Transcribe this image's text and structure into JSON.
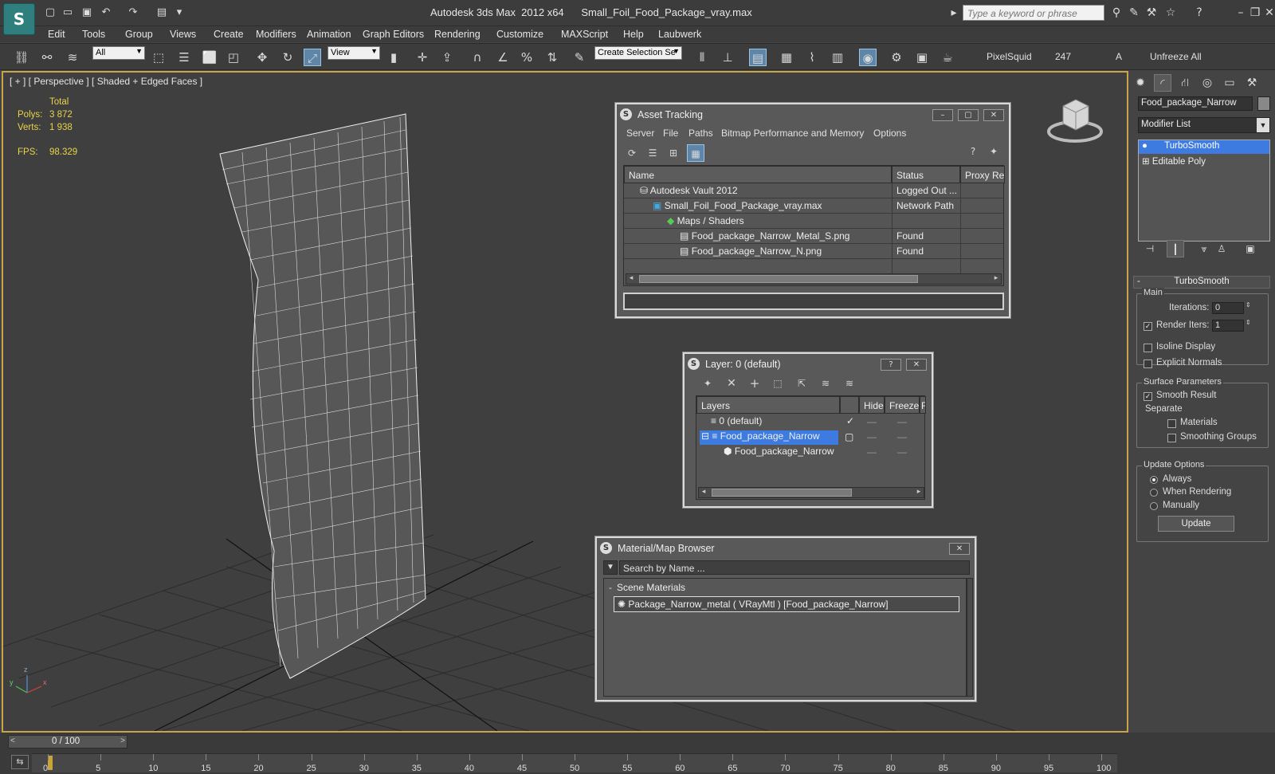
{
  "app": {
    "window_title": "Autodesk 3ds Max  2012 x64      Small_Foil_Food_Package_vray.max",
    "search_placeholder": "Type a keyword or phrase",
    "logo_glyph": "S"
  },
  "menubar": [
    "Edit",
    "Tools",
    "Group",
    "Views",
    "Create",
    "Modifiers",
    "Animation",
    "Graph Editors",
    "Rendering",
    "Customize",
    "MAXScript",
    "Help",
    "Laubwerk"
  ],
  "toolbar": {
    "selection_filter": "All",
    "ref_coord": "View",
    "named_selection": "Create Selection Se",
    "pixelsquid": "PixelSquid",
    "count": "247",
    "letter": "A",
    "unfreeze": "Unfreeze All"
  },
  "viewport": {
    "label": "[ + ] [ Perspective ] [ Shaded + Edged Faces ]",
    "stats_header": "Total",
    "polys_label": "Polys:",
    "polys_value": "3 872",
    "verts_label": "Verts:",
    "verts_value": "1 938",
    "fps_label": "FPS:",
    "fps_value": "98.329",
    "axis_x": "x",
    "axis_y": "y",
    "axis_z": "z"
  },
  "asset_tracking": {
    "title": "Asset Tracking",
    "menus": [
      "Server",
      "File",
      "Paths",
      "Bitmap Performance and Memory",
      "Options"
    ],
    "columns": [
      "Name",
      "Status",
      "Proxy Res"
    ],
    "rows": [
      {
        "name": "Autodesk Vault 2012",
        "status": "Logged Out ..."
      },
      {
        "name": "Small_Foil_Food_Package_vray.max",
        "status": "Network Path"
      },
      {
        "name": "Maps / Shaders",
        "status": ""
      },
      {
        "name": "Food_package_Narrow_Metal_S.png",
        "status": "Found"
      },
      {
        "name": "Food_package_Narrow_N.png",
        "status": "Found"
      }
    ]
  },
  "layer": {
    "title": "Layer: 0 (default)",
    "columns": [
      "Layers",
      "Hide",
      "Freeze",
      "R"
    ],
    "rows": [
      {
        "name": "0 (default)"
      },
      {
        "name": "Food_package_Narrow"
      },
      {
        "name": "Food_package_Narrow"
      }
    ]
  },
  "material_browser": {
    "title": "Material/Map Browser",
    "search_placeholder": "Search by Name ...",
    "section": "Scene Materials",
    "item": "Package_Narrow_metal  ( VRayMtl )  [Food_package_Narrow]"
  },
  "command_panel": {
    "object_name": "Food_package_Narrow",
    "modifier_list": "Modifier List",
    "stack": [
      "TurboSmooth",
      "Editable Poly"
    ],
    "rollout_title": "TurboSmooth",
    "main_group": "Main",
    "iterations_label": "Iterations:",
    "iterations_value": "0",
    "render_iters_label": "Render Iters:",
    "render_iters_value": "1",
    "isoline": "Isoline Display",
    "explicit_normals": "Explicit Normals",
    "surface_group": "Surface Parameters",
    "smooth_result": "Smooth Result",
    "separate": "Separate",
    "materials": "Materials",
    "smoothing_groups": "Smoothing Groups",
    "update_group": "Update Options",
    "always": "Always",
    "when_rendering": "When Rendering",
    "manually": "Manually",
    "update_button": "Update"
  },
  "timeline": {
    "slider_text": "0 / 100",
    "ticks": [
      "0",
      "5",
      "10",
      "15",
      "20",
      "25",
      "30",
      "35",
      "40",
      "45",
      "50",
      "55",
      "60",
      "65",
      "70",
      "75",
      "80",
      "85",
      "90",
      "95",
      "100"
    ]
  },
  "colors": {
    "viewport_border": "#c9a54a",
    "stats_text": "#e9d34a",
    "selection_blue": "#3d7be0"
  }
}
